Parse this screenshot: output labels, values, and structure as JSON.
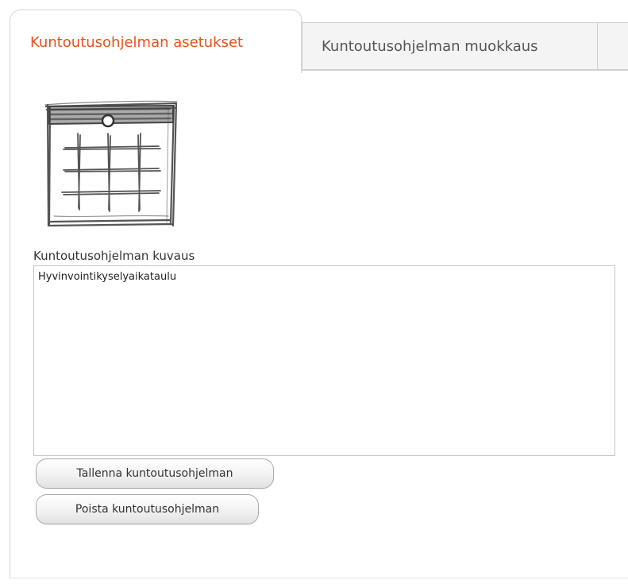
{
  "tabs": {
    "settings_label": "Kuntoutusohjelman asetukset",
    "edit_label": "Kuntoutusohjelman muokkaus"
  },
  "icons": {
    "program_icon": "calendar-icon"
  },
  "colors": {
    "active_tab_text": "#e8501c",
    "inactive_tab_bg": "#f4f4f4",
    "border": "#d4d4d4"
  },
  "form": {
    "description_label": "Kuntoutusohjelman kuvaus",
    "description_value": "Hyvinvointikyselyaikataulu"
  },
  "actions": {
    "save_label": "Tallenna kuntoutusohjelman",
    "delete_label": "Poista kuntoutusohjelman"
  }
}
